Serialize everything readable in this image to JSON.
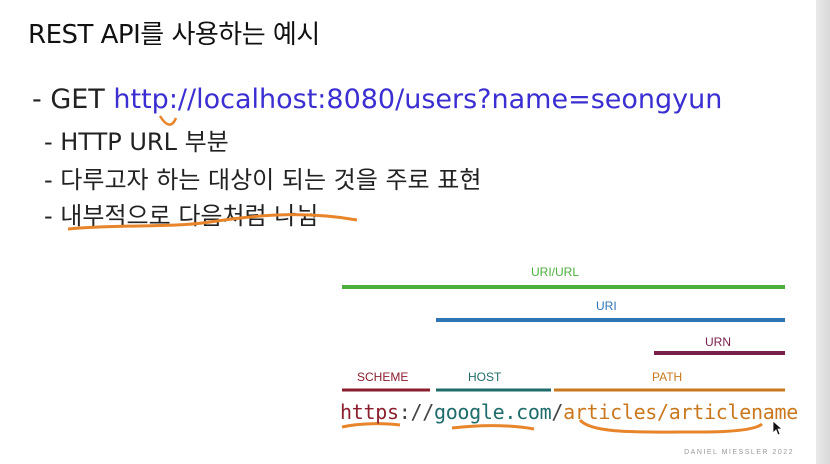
{
  "slide": {
    "title": "REST API를 사용하는 예시",
    "bullets": {
      "b1_prefix": "- GET ",
      "b1_url": "http://localhost:8080/users?name=seongyun",
      "b2": "- HTTP URL 부분",
      "b3": "- 다루고자 하는 대상이 되는 것을 주로 표현",
      "b4": "- 내부적으로 다음처럼 나뉨"
    }
  },
  "diagram": {
    "labels": {
      "uri_url": "URI/URL",
      "uri": "URI",
      "urn": "URN",
      "scheme": "SCHEME",
      "host": "HOST",
      "path": "PATH"
    },
    "url_segments": {
      "scheme": "https",
      "sep1": "://",
      "host": "google.com",
      "sep2": "/",
      "path": "articles/articlename"
    },
    "credit": "DANIEL MIESSLER 2022",
    "colors": {
      "uri_url": "#4caf3d",
      "uri": "#2f74b5",
      "urn": "#7a1f4a",
      "scheme": "#8a1e2e",
      "host": "#1f6b6b",
      "path": "#c9781e",
      "annotation": "#e8852a"
    }
  }
}
